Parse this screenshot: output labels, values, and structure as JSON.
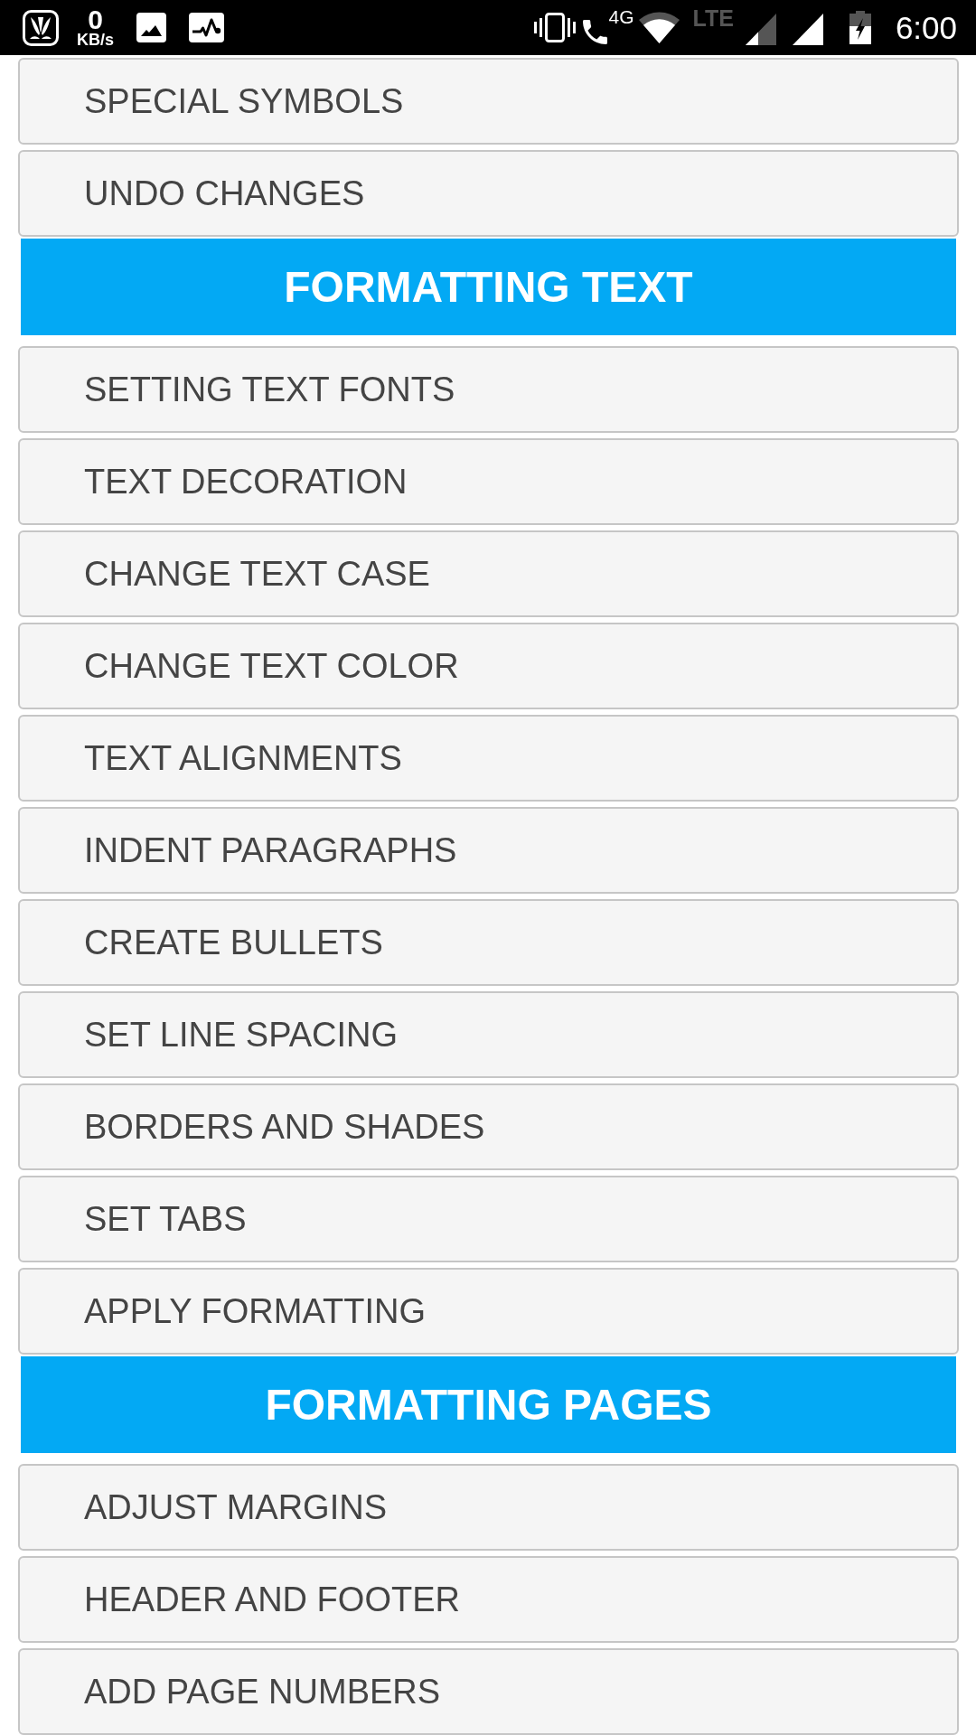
{
  "status_bar": {
    "network_speed": {
      "value": "0",
      "unit": "KB/s"
    },
    "call_network": "4G",
    "mobile_data": "LTE",
    "time": "6:00"
  },
  "list": [
    {
      "kind": "item",
      "label": "SPECIAL SYMBOLS"
    },
    {
      "kind": "item",
      "label": "UNDO CHANGES"
    },
    {
      "kind": "header",
      "label": "FORMATTING TEXT"
    },
    {
      "kind": "item",
      "label": "SETTING TEXT FONTS"
    },
    {
      "kind": "item",
      "label": "TEXT DECORATION"
    },
    {
      "kind": "item",
      "label": "CHANGE TEXT CASE"
    },
    {
      "kind": "item",
      "label": "CHANGE TEXT COLOR"
    },
    {
      "kind": "item",
      "label": "TEXT ALIGNMENTS"
    },
    {
      "kind": "item",
      "label": "INDENT PARAGRAPHS"
    },
    {
      "kind": "item",
      "label": "CREATE BULLETS"
    },
    {
      "kind": "item",
      "label": "SET LINE SPACING"
    },
    {
      "kind": "item",
      "label": "BORDERS AND SHADES"
    },
    {
      "kind": "item",
      "label": "SET TABS"
    },
    {
      "kind": "item",
      "label": "APPLY FORMATTING"
    },
    {
      "kind": "header",
      "label": "FORMATTING PAGES"
    },
    {
      "kind": "item",
      "label": "ADJUST MARGINS"
    },
    {
      "kind": "item",
      "label": "HEADER AND FOOTER"
    },
    {
      "kind": "item",
      "label": "ADD PAGE NUMBERS"
    }
  ]
}
